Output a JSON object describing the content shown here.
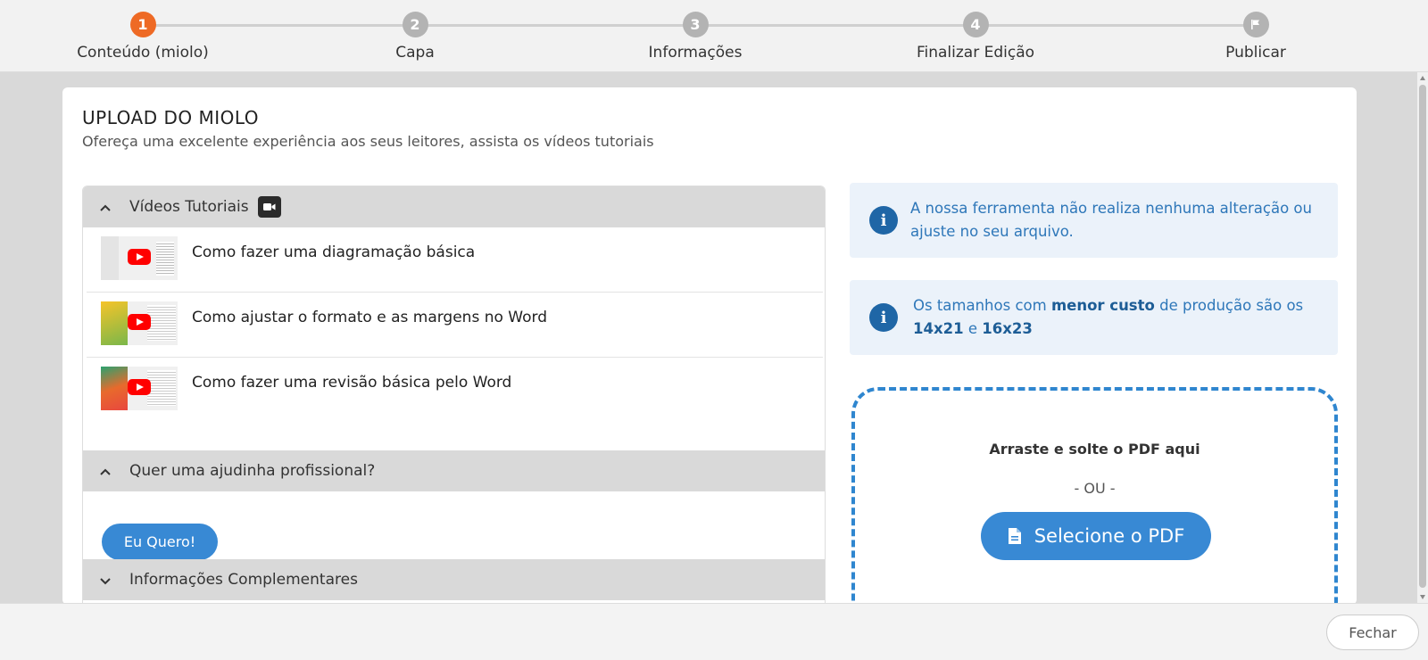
{
  "stepper": {
    "steps": [
      {
        "number": "1",
        "label": "Conteúdo (miolo)",
        "active": true
      },
      {
        "number": "2",
        "label": "Capa",
        "active": false
      },
      {
        "number": "3",
        "label": "Informações",
        "active": false
      },
      {
        "number": "4",
        "label": "Finalizar Edição",
        "active": false
      },
      {
        "number": "",
        "icon": "flag-icon",
        "label": "Publicar",
        "active": false
      }
    ]
  },
  "page": {
    "title": "UPLOAD DO MIOLO",
    "subtitle": "Ofereça uma excelente experiência aos seus leitores, assista os vídeos tutoriais"
  },
  "accordion": {
    "tutorials": {
      "label": "Vídeos Tutoriais",
      "icon": "video-camera-icon",
      "videos": [
        {
          "title": "Como fazer uma diagramação básica"
        },
        {
          "title": "Como ajustar o formato e as margens no Word"
        },
        {
          "title": "Como fazer uma revisão básica pelo Word"
        }
      ]
    },
    "help": {
      "label": "Quer uma ajudinha profissional?",
      "button_label": "Eu Quero!"
    },
    "extra": {
      "label": "Informações Complementares"
    }
  },
  "info_boxes": {
    "first": {
      "text": "A nossa ferramenta não realiza nenhuma alteração ou ajuste no seu arquivo."
    },
    "second": {
      "text_1": "Os tamanhos com ",
      "bold_1": "menor custo",
      "text_2": " de produção são os ",
      "bold_2": "14x21",
      "text_3": " e ",
      "bold_3": "16x23"
    }
  },
  "dropzone": {
    "drag_text": "Arraste e solte o PDF aqui",
    "or_text": "- OU -",
    "button_label": "Selecione o PDF"
  },
  "footer": {
    "close_label": "Fechar"
  },
  "colors": {
    "active_step": "#ee6a25",
    "inactive_step": "#b3b3b3",
    "primary_button": "#3889d4",
    "info_bg": "#ebf2fa",
    "info_text": "#2e77b9",
    "dropzone_border": "#2f86cf"
  }
}
